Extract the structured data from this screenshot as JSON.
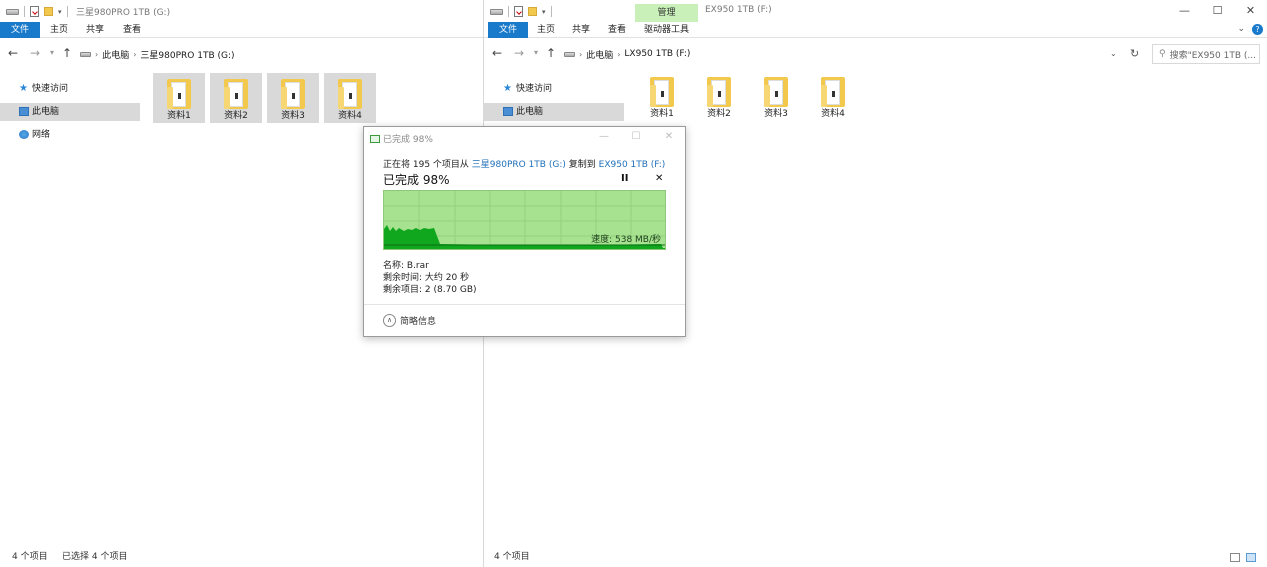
{
  "left_window": {
    "title": "三星980PRO 1TB (G:)",
    "tabs": [
      "文件",
      "主页",
      "共享",
      "查看"
    ],
    "breadcrumb": [
      "此电脑",
      "三星980PRO 1TB (G:)"
    ],
    "nav_items": [
      "快速访问",
      "此电脑",
      "网络"
    ],
    "folders": [
      "资料1",
      "资料2",
      "资料3",
      "资料4"
    ],
    "status_count": "4 个项目",
    "status_selected": "已选择 4 个项目"
  },
  "right_window": {
    "title": "EX950 1TB (F:)",
    "context_tab_header": "管理",
    "tabs": [
      "文件",
      "主页",
      "共享",
      "查看",
      "驱动器工具"
    ],
    "breadcrumb": [
      "此电脑",
      "LX950 1TB (F:)"
    ],
    "search_placeholder": "搜索\"EX950 1TB (...",
    "nav_items": [
      "快速访问",
      "此电脑"
    ],
    "folders": [
      "资料1",
      "资料2",
      "资料3",
      "资料4"
    ],
    "status_count": "4 个项目"
  },
  "copy_dialog": {
    "title": "已完成 98%",
    "line_prefix": "正在将 195 个项目从",
    "source": "三星980PRO 1TB (G:)",
    "line_middle": "复制到",
    "destination": "EX950 1TB (F:)",
    "percent_label": "已完成 98%",
    "progress": 0.98,
    "pause_icon": "pause-icon",
    "cancel_icon": "close-icon",
    "speed": "速度: 538 MB/秒",
    "name": "名称: B.rar",
    "time_remaining": "剩余时间: 大约 20 秒",
    "items_remaining": "剩余项目: 2 (8.70 GB)",
    "details_toggle": "简略信息"
  },
  "colors": {
    "file_tab": "#1979ca",
    "context_tab": "#c8f0b8",
    "graph_bg": "#a6e28f",
    "graph_fill": "#10a61e",
    "link": "#1f6fb8"
  }
}
